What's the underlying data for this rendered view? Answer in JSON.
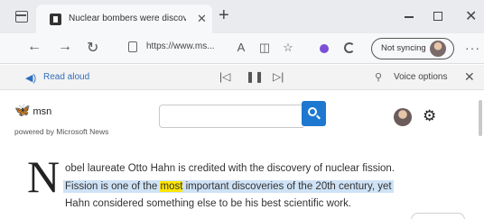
{
  "browser": {
    "tab": {
      "title": "Nuclear bombers were discover"
    },
    "address_bar": {
      "url": "https://www.ms..."
    },
    "sync": {
      "label": "Not syncing"
    }
  },
  "read_aloud": {
    "label": "Read aloud",
    "voice_options_label": "Voice options",
    "icons": [
      "read-aloud-icon",
      "previous-icon",
      "pause-icon",
      "next-icon",
      "voice-options-icon",
      "close-icon"
    ]
  },
  "page": {
    "logo_text": "msn",
    "powered_by": "powered by Microsoft News",
    "search": {
      "placeholder": ""
    },
    "article": {
      "dropcap": "N",
      "line1": "obel laureate Otto Hahn is credited with the discovery of nuclear fission.",
      "line2_before": "Fission is one of the ",
      "line2_highlight": "most",
      "line2_after": " important discoveries of the 20th century, yet",
      "line3": "Hahn considered something else to be his best scientific work."
    }
  },
  "colors": {
    "accent": "#1e78d0",
    "read_aloud_blue": "#2f6fbf",
    "selection": "#cfe2f6",
    "word_highlight": "#ffe600"
  }
}
